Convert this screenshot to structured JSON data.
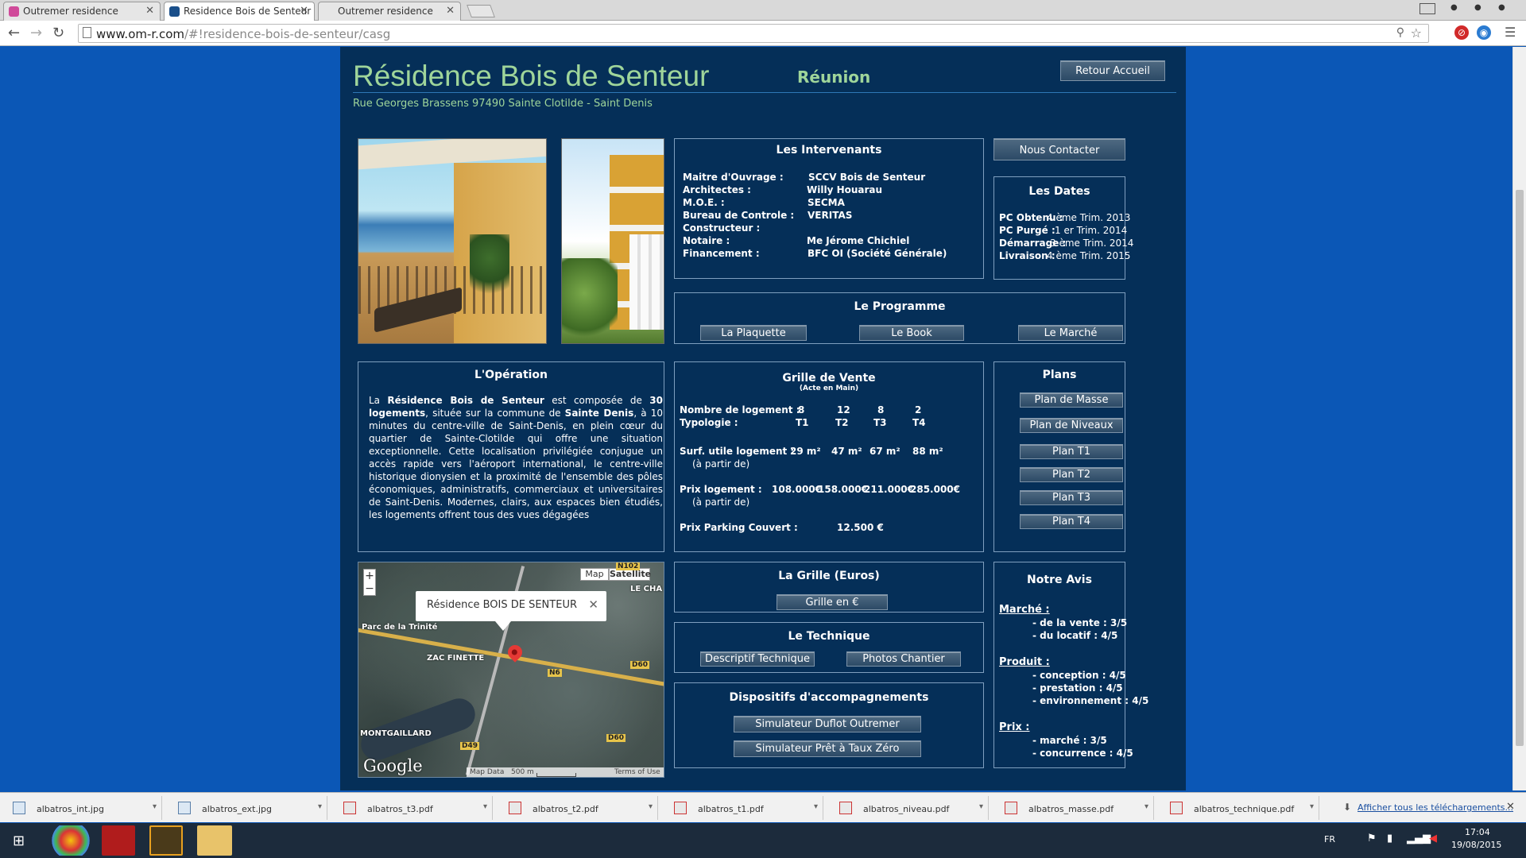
{
  "browser": {
    "tabs": [
      {
        "label": "Outremer residence"
      },
      {
        "label": "Residence Bois de Senteur"
      },
      {
        "label": "Outremer residence"
      }
    ],
    "url_host": "www.om-r.com",
    "url_path": "/#!residence-bois-de-senteur/casg"
  },
  "header": {
    "title": "Résidence Bois de Senteur",
    "region": "Réunion",
    "address": "Rue Georges Brassens 97490 Sainte Clotilde - Saint Denis",
    "back_button": "Retour Accueil"
  },
  "intervenants": {
    "title": "Les Intervenants",
    "rows": [
      {
        "label": "Maitre d'Ouvrage :",
        "value": "SCCV Bois de Senteur"
      },
      {
        "label": "Architectes :",
        "value": "Willy Houarau"
      },
      {
        "label": "M.O.E. :",
        "value": "SECMA"
      },
      {
        "label": "Bureau de Controle :",
        "value": "VERITAS"
      },
      {
        "label": "Constructeur :",
        "value": ""
      },
      {
        "label": "Notaire :",
        "value": "Me Jérome Chichiel"
      },
      {
        "label": "Financement :",
        "value": "BFC OI (Société Générale)"
      }
    ]
  },
  "contact_button": "Nous Contacter",
  "dates": {
    "title": "Les Dates",
    "rows": [
      {
        "label": "PC Obtenu :",
        "value": "4 ème Trim. 2013"
      },
      {
        "label": "PC Purgé :",
        "value": "1 er Trim. 2014"
      },
      {
        "label": "Démarrage :",
        "value": "3 ème Trim. 2014"
      },
      {
        "label": "Livraison :",
        "value": "4 ème Trim. 2015"
      }
    ]
  },
  "programme": {
    "title": "Le Programme",
    "buttons": [
      "La Plaquette",
      "Le Book",
      "Le Marché"
    ]
  },
  "operation": {
    "title": "L'Opération",
    "p1": "La ",
    "b1": "Résidence Bois de Senteur",
    "p2": " est composée de ",
    "b2": "30 logements",
    "p3": ", située sur la commune de ",
    "b3": "Sainte Denis",
    "p4": ", à 10 minutes du centre-ville de Saint-Denis, en plein cœur du quartier de Sainte-Clotilde qui offre une situation exceptionnelle. Cette localisation privilégiée conjugue un accès rapide vers l'aéroport international, le centre-ville historique dionysien et la proximité de l'ensemble des pôles économiques, administratifs, commerciaux et universitaires de Saint-Denis. Modernes, clairs, aux espaces bien étudiés, les logements offrent tous des vues dégagées"
  },
  "grille_vente": {
    "title": "Grille de Vente",
    "subtitle": "(Acte en Main)",
    "nb_label": "Nombre de logement :",
    "nb_values": [
      "8",
      "12",
      "8",
      "2"
    ],
    "typo_label": "Typologie :",
    "typo_values": [
      "T1",
      "T2",
      "T3",
      "T4"
    ],
    "surf_label": "Surf. utile logement :",
    "surf_values": [
      "29 m²",
      "47 m²",
      "67 m²",
      "88 m²"
    ],
    "surf_note": "(à partir de)",
    "prix_label": "Prix logement :",
    "prix_values": [
      "108.000€",
      "158.000€",
      "211.000€",
      "285.000€"
    ],
    "prix_note": "(à partir de)",
    "parking_label": "Prix Parking Couvert :",
    "parking_value": "12.500 €"
  },
  "plans": {
    "title": "Plans",
    "buttons": [
      "Plan de Masse",
      "Plan de Niveaux",
      "Plan T1",
      "Plan T2",
      "Plan T3",
      "Plan T4"
    ]
  },
  "map": {
    "type_map": "Map",
    "type_satellite": "Satellite",
    "info_title": "Résidence BOIS DE SENTEUR",
    "labels": {
      "trinite": "Parc de la Trinité",
      "finette": "ZAC FINETTE",
      "montgaillard": "MONTGAILLARD",
      "le_cha": "LE CHA"
    },
    "shields": [
      "N102",
      "D60",
      "N6",
      "D49",
      "D60"
    ],
    "google": "Google",
    "map_data": "Map Data",
    "scale": "500 m",
    "terms": "Terms of Use"
  },
  "grille_euros": {
    "title": "La Grille (Euros)",
    "button": "Grille en €"
  },
  "technique": {
    "title": "Le Technique",
    "buttons": [
      "Descriptif Technique",
      "Photos Chantier"
    ]
  },
  "dispositifs": {
    "title": "Dispositifs  d'accompagnements",
    "buttons": [
      "Simulateur Duflot Outremer",
      "Simulateur Prêt à Taux Zéro"
    ]
  },
  "avis": {
    "title": "Notre Avis",
    "marche": "Marché :",
    "marche_items": [
      "- de la vente : 3/5",
      "- du locatif :  4/5"
    ],
    "produit": "Produit :",
    "produit_items": [
      "- conception : 4/5",
      "- prestation : 4/5",
      "- environnement : 4/5"
    ],
    "prix": "Prix :",
    "prix_items": [
      "- marché : 3/5",
      "- concurrence : 4/5"
    ]
  },
  "downloads": {
    "items": [
      "albatros_int.jpg",
      "albatros_ext.jpg",
      "albatros_t3.pdf",
      "albatros_t2.pdf",
      "albatros_t1.pdf",
      "albatros_niveau.pdf",
      "albatros_masse.pdf",
      "albatros_technique.pdf"
    ],
    "show_all": "Afficher tous les téléchargements..."
  },
  "taskbar": {
    "lang": "FR",
    "time": "17:04",
    "date": "19/08/2015"
  }
}
